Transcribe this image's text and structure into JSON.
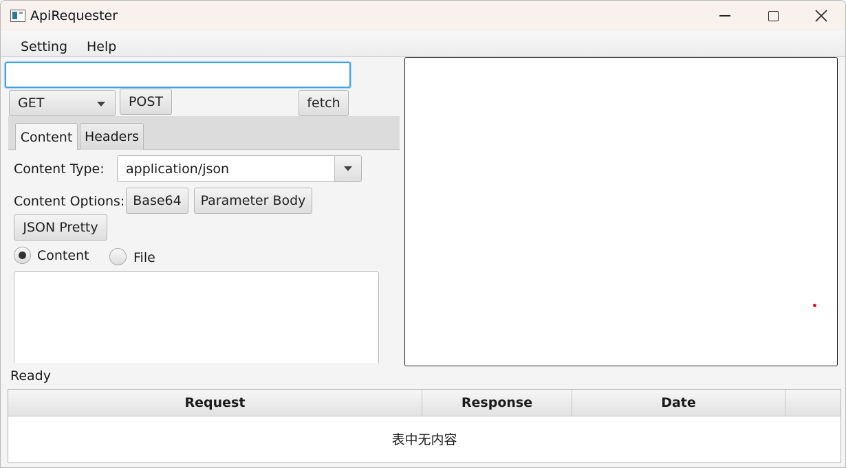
{
  "window": {
    "title": "ApiRequester"
  },
  "menu": {
    "items": [
      "Setting",
      "Help"
    ]
  },
  "request": {
    "url_value": "",
    "method_selected": "GET",
    "post_label": "POST",
    "fetch_label": "fetch"
  },
  "tabs": [
    {
      "label": "Content",
      "selected": true
    },
    {
      "label": "Headers",
      "selected": false
    }
  ],
  "content_tab": {
    "content_type_label": "Content Type:",
    "content_type_value": "application/json",
    "content_options_label": "Content Options:",
    "base64_label": "Base64",
    "parameter_body_label": "Parameter Body",
    "json_pretty_label": "JSON Pretty",
    "radio_content_label": "Content",
    "radio_file_label": "File",
    "radio_selected": "Content",
    "body_value": ""
  },
  "status": {
    "text": "Ready"
  },
  "history_table": {
    "columns": [
      "Request",
      "Response",
      "Date"
    ],
    "empty_text": "表中无内容"
  },
  "colors": {
    "focus_border": "#3fa2e6",
    "title_bar": "#f9f1ee",
    "marker_dot": "#e01020"
  }
}
